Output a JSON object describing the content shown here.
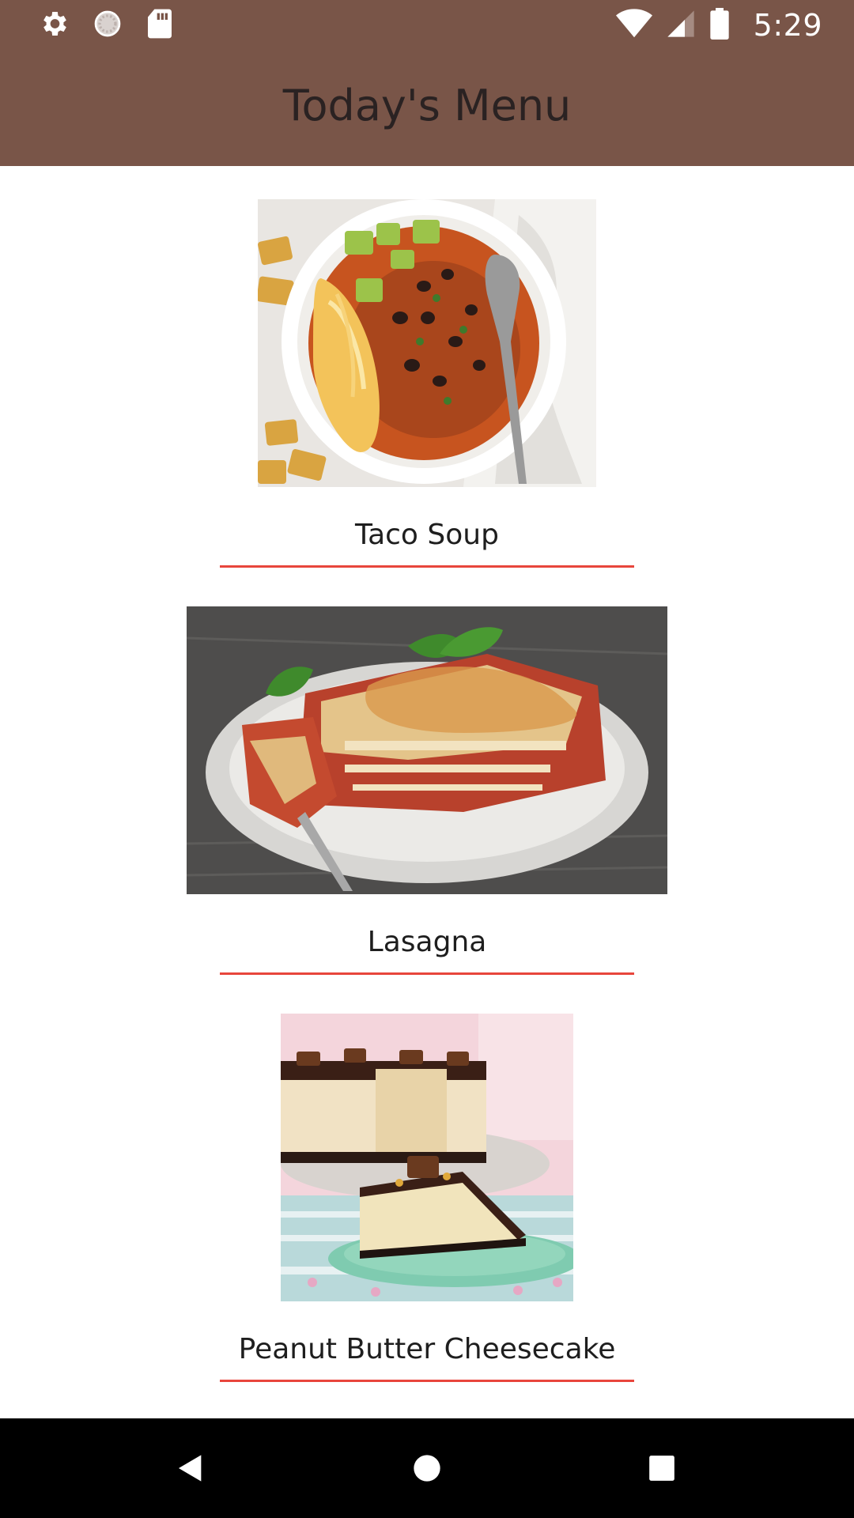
{
  "status_bar": {
    "time": "5:29",
    "left_icons": [
      "gear-icon",
      "loading-circle-icon",
      "sd-card-icon"
    ],
    "right_icons": [
      "wifi-icon",
      "signal-icon",
      "battery-icon"
    ]
  },
  "app_bar": {
    "title": "Today's Menu",
    "background_color": "#795548"
  },
  "menu": {
    "items": [
      {
        "name": "Taco Soup",
        "image": "taco-soup-photo"
      },
      {
        "name": "Lasagna",
        "image": "lasagna-photo"
      },
      {
        "name": "Peanut Butter Cheesecake",
        "image": "peanut-butter-cheesecake-photo"
      }
    ],
    "underline_color": "#e8463c"
  },
  "nav_bar": {
    "buttons": [
      "back-icon",
      "home-icon",
      "recents-icon"
    ]
  }
}
